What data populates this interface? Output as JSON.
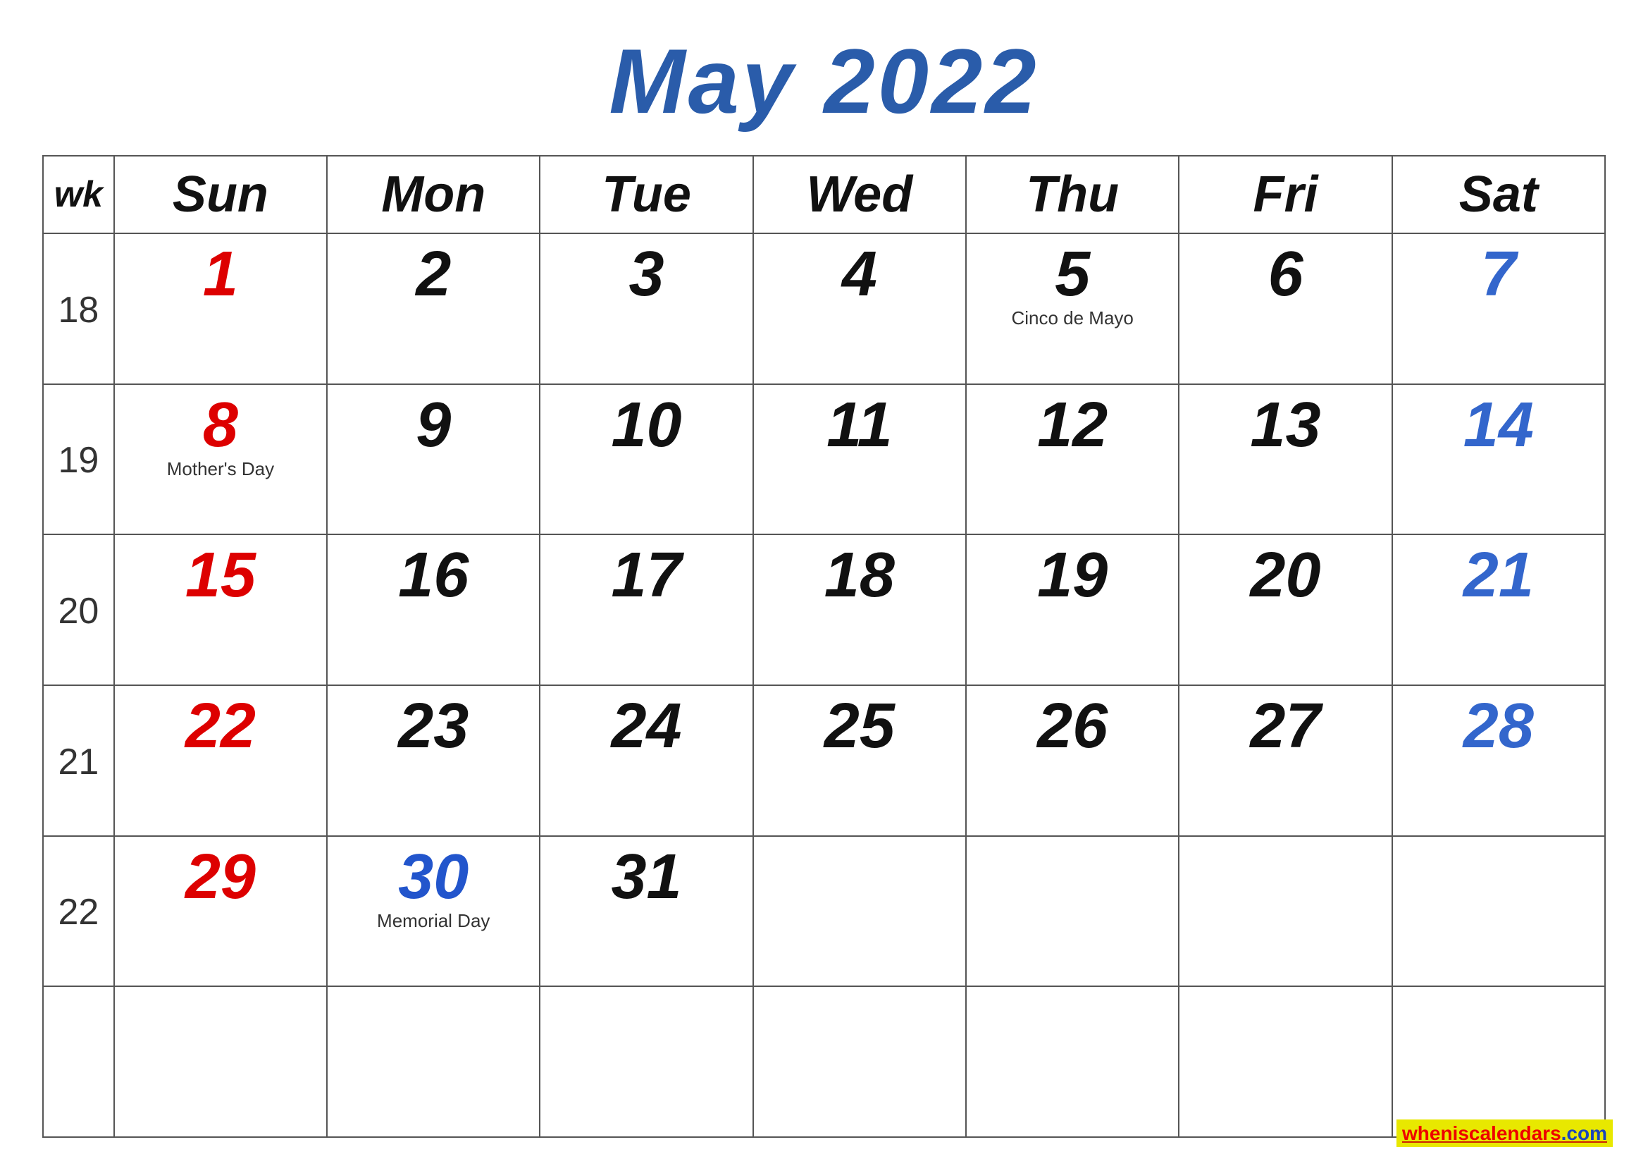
{
  "title": "May 2022",
  "header": {
    "columns": [
      {
        "key": "wk",
        "label": "wk"
      },
      {
        "key": "sun",
        "label": "Sun"
      },
      {
        "key": "mon",
        "label": "Mon"
      },
      {
        "key": "tue",
        "label": "Tue"
      },
      {
        "key": "wed",
        "label": "Wed"
      },
      {
        "key": "thu",
        "label": "Thu"
      },
      {
        "key": "fri",
        "label": "Fri"
      },
      {
        "key": "sat",
        "label": "Sat"
      }
    ]
  },
  "weeks": [
    {
      "wk": "18",
      "days": [
        {
          "num": "1",
          "color": "red",
          "holiday": ""
        },
        {
          "num": "2",
          "color": "black",
          "holiday": ""
        },
        {
          "num": "3",
          "color": "black",
          "holiday": ""
        },
        {
          "num": "4",
          "color": "black",
          "holiday": ""
        },
        {
          "num": "5",
          "color": "black",
          "holiday": "Cinco de Mayo"
        },
        {
          "num": "6",
          "color": "black",
          "holiday": ""
        },
        {
          "num": "7",
          "color": "blue",
          "holiday": ""
        }
      ]
    },
    {
      "wk": "19",
      "days": [
        {
          "num": "8",
          "color": "red",
          "holiday": "Mother's Day"
        },
        {
          "num": "9",
          "color": "black",
          "holiday": ""
        },
        {
          "num": "10",
          "color": "black",
          "holiday": ""
        },
        {
          "num": "11",
          "color": "black",
          "holiday": ""
        },
        {
          "num": "12",
          "color": "black",
          "holiday": ""
        },
        {
          "num": "13",
          "color": "black",
          "holiday": ""
        },
        {
          "num": "14",
          "color": "blue",
          "holiday": ""
        }
      ]
    },
    {
      "wk": "20",
      "days": [
        {
          "num": "15",
          "color": "red",
          "holiday": ""
        },
        {
          "num": "16",
          "color": "black",
          "holiday": ""
        },
        {
          "num": "17",
          "color": "black",
          "holiday": ""
        },
        {
          "num": "18",
          "color": "black",
          "holiday": ""
        },
        {
          "num": "19",
          "color": "black",
          "holiday": ""
        },
        {
          "num": "20",
          "color": "black",
          "holiday": ""
        },
        {
          "num": "21",
          "color": "blue",
          "holiday": ""
        }
      ]
    },
    {
      "wk": "21",
      "days": [
        {
          "num": "22",
          "color": "red",
          "holiday": ""
        },
        {
          "num": "23",
          "color": "black",
          "holiday": ""
        },
        {
          "num": "24",
          "color": "black",
          "holiday": ""
        },
        {
          "num": "25",
          "color": "black",
          "holiday": ""
        },
        {
          "num": "26",
          "color": "black",
          "holiday": ""
        },
        {
          "num": "27",
          "color": "black",
          "holiday": ""
        },
        {
          "num": "28",
          "color": "blue",
          "holiday": ""
        }
      ]
    },
    {
      "wk": "22",
      "days": [
        {
          "num": "29",
          "color": "red",
          "holiday": ""
        },
        {
          "num": "30",
          "color": "holiday",
          "holiday": "Memorial Day"
        },
        {
          "num": "31",
          "color": "black",
          "holiday": ""
        },
        {
          "num": "",
          "color": "black",
          "holiday": ""
        },
        {
          "num": "",
          "color": "black",
          "holiday": ""
        },
        {
          "num": "",
          "color": "black",
          "holiday": ""
        },
        {
          "num": "",
          "color": "black",
          "holiday": ""
        }
      ]
    },
    {
      "wk": "",
      "days": [
        {
          "num": "",
          "color": "black",
          "holiday": ""
        },
        {
          "num": "",
          "color": "black",
          "holiday": ""
        },
        {
          "num": "",
          "color": "black",
          "holiday": ""
        },
        {
          "num": "",
          "color": "black",
          "holiday": ""
        },
        {
          "num": "",
          "color": "black",
          "holiday": ""
        },
        {
          "num": "",
          "color": "black",
          "holiday": ""
        },
        {
          "num": "",
          "color": "black",
          "holiday": ""
        }
      ]
    }
  ],
  "watermark": {
    "text1": "wheniscalendars",
    "text2": ".com"
  }
}
